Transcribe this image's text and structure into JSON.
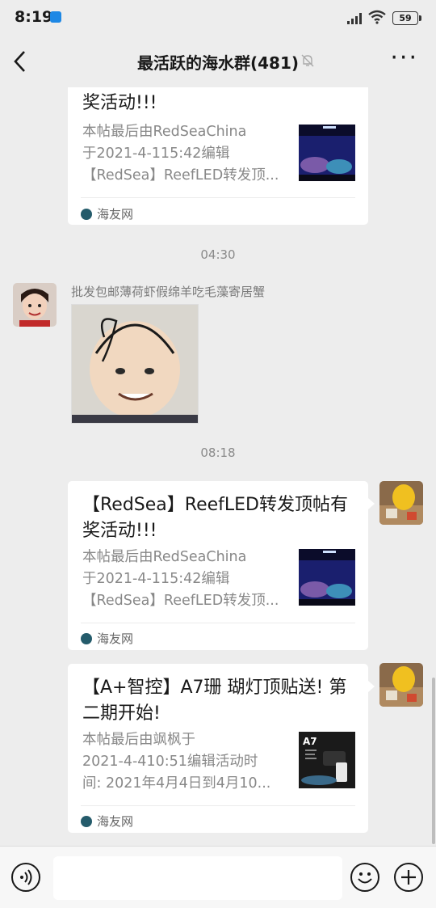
{
  "status_bar": {
    "time": "8:19",
    "battery": "59"
  },
  "header": {
    "back_icon": "chevron-left-icon",
    "title": "最活跃的海水群(481)",
    "mute_icon": "bell-off-icon",
    "more_icon": "more-icon"
  },
  "messages": {
    "card1": {
      "title_fragment": "奖活动!!!",
      "desc": [
        "本帖最后由RedSeaChina",
        "于2021-4-115:42编辑",
        "【RedSea】ReefLED转发顶..."
      ],
      "source": "海友网"
    },
    "time1": "04:30",
    "sender_name": "批发包邮薄荷虾假绵羊吃毛藻寄居蟹",
    "time2": "08:18",
    "card2": {
      "title": "【RedSea】ReefLED转发顶帖有奖活动!!!",
      "desc": [
        "本帖最后由RedSeaChina",
        "于2021-4-115:42编辑",
        "【RedSea】ReefLED转发顶..."
      ],
      "source": "海友网"
    },
    "card3": {
      "title": "【A+智控】A7珊 瑚灯顶贴送! 第二期开始!",
      "desc": [
        "本帖最后由飒枫于",
        "2021-4-410:51编辑活动时",
        "间: 2021年4月4日到4月10..."
      ],
      "source": "海友网",
      "thumb_label": "A7"
    }
  },
  "bottom_bar": {
    "voice_icon": "voice-icon",
    "input_value": "",
    "emoji_icon": "emoji-icon",
    "plus_icon": "plus-icon"
  },
  "colors": {
    "background": "#ededed",
    "card": "#ffffff",
    "text": "#191919",
    "muted": "#888888"
  }
}
